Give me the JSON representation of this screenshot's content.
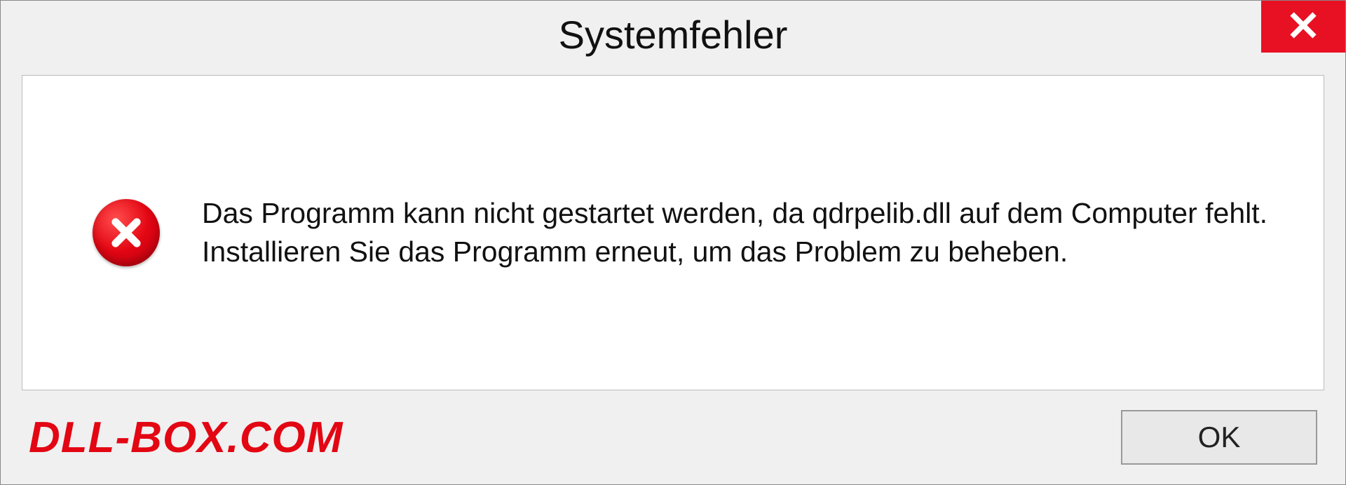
{
  "titlebar": {
    "title": "Systemfehler"
  },
  "content": {
    "message": "Das Programm kann nicht gestartet werden, da qdrpelib.dll auf dem Computer fehlt. Installieren Sie das Programm erneut, um das Problem zu beheben."
  },
  "footer": {
    "watermark": "DLL-BOX.COM",
    "ok_label": "OK"
  }
}
